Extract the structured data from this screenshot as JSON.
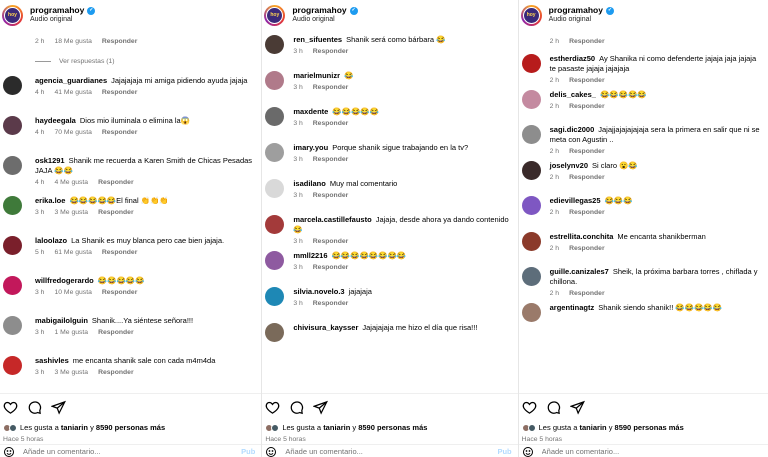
{
  "header": {
    "username": "programahoy",
    "audio": "Audio original",
    "logo_text": "hoy"
  },
  "panels": [
    {
      "top_meta": {
        "time": "2 h",
        "likes": "18 Me gusta",
        "reply": "Responder"
      },
      "view_replies": "Ver respuestas (1)",
      "comments": [
        {
          "user": "agencia_guardianes",
          "text": "Jajajajaja mi amiga pidiendo ayuda jajaja",
          "time": "4 h",
          "likes": "41 Me gusta",
          "reply": "Responder",
          "color": "#2b2b2b"
        },
        {
          "user": "haydeegala",
          "text": "Dios mio iluminala o elimina la😱",
          "time": "4 h",
          "likes": "70 Me gusta",
          "reply": "Responder",
          "color": "#5b3a4a"
        },
        {
          "user": "osk1291",
          "text": "Shanik me recuerda a Karen Smith de Chicas Pesadas JAJA 😂😂",
          "time": "4 h",
          "likes": "4 Me gusta",
          "reply": "Responder",
          "color": "#6d6d6d"
        },
        {
          "user": "erika.loe",
          "text": "😂😂😂😂😂El final 👏👏👏",
          "time": "3 h",
          "likes": "3 Me gusta",
          "reply": "Responder",
          "color": "#3f7a3a"
        },
        {
          "user": "laloolazo",
          "text": "La Shanik es muy blanca pero cae bien jajaja.",
          "time": "5 h",
          "likes": "61 Me gusta",
          "reply": "Responder",
          "color": "#7a1f2b"
        },
        {
          "user": "willfredogerardo",
          "text": "😂😂😂😂😂",
          "time": "3 h",
          "likes": "10 Me gusta",
          "reply": "Responder",
          "color": "#c2185b"
        },
        {
          "user": "mabigailolguin",
          "text": "Shanik....Ya siéntese señora!!!",
          "time": "3 h",
          "likes": "1 Me gusta",
          "reply": "Responder",
          "color": "#8d8d8d"
        },
        {
          "user": "sashivles",
          "text": "me encanta shanik sale con cada m4m4da",
          "time": "3 h",
          "likes": "3 Me gusta",
          "reply": "Responder",
          "color": "#c62828"
        }
      ],
      "likes_prefix": "Les gusta a",
      "likes_user": "taniarin",
      "likes_joiner": "y",
      "likes_count": "8590 personas más",
      "posted": "Hace 5 horas",
      "add_comment": "Añade un comentario...",
      "post": "Pub"
    },
    {
      "comments": [
        {
          "user": "ren_sifuentes",
          "text": "Shanik será como bárbara 😂",
          "time": "3 h",
          "likes": "",
          "reply": "Responder",
          "color": "#4a3b35"
        },
        {
          "user": "marielmunizr",
          "text": "😂",
          "time": "3 h",
          "likes": "",
          "reply": "Responder",
          "color": "#b07a8a"
        },
        {
          "user": "maxdente",
          "text": "😂😂😂😂😂",
          "time": "3 h",
          "likes": "",
          "reply": "Responder",
          "color": "#6a6a6a"
        },
        {
          "user": "imary.you",
          "text": "Porque shanik sigue trabajando en la tv?",
          "time": "3 h",
          "likes": "",
          "reply": "Responder",
          "color": "#9e9e9e"
        },
        {
          "user": "isadilano",
          "text": "Muy mal comentario",
          "time": "3 h",
          "likes": "",
          "reply": "Responder",
          "color": "#d9d9d9"
        },
        {
          "user": "marcela.castillefausto",
          "text": "Jajaja, desde ahora ya dando contenido 😂",
          "time": "3 h",
          "likes": "",
          "reply": "Responder",
          "color": "#a33a3a"
        },
        {
          "user": "mmll2216",
          "text": "😂😂😂😂😂😂😂😂",
          "time": "3 h",
          "likes": "",
          "reply": "Responder",
          "color": "#8e5aa0"
        },
        {
          "user": "silvia.novelo.3",
          "text": "jajajaja",
          "time": "3 h",
          "likes": "",
          "reply": "Responder",
          "color": "#1e88b5"
        },
        {
          "user": "chivisura_kaysser",
          "text": "Jajajajaja me hizo el día que risa!!!",
          "time": "",
          "likes": "",
          "reply": "",
          "color": "#7a6a5a"
        }
      ],
      "likes_prefix": "Les gusta a",
      "likes_user": "taniarin",
      "likes_joiner": "y",
      "likes_count": "8590 personas más",
      "posted": "Hace 5 horas",
      "add_comment": "Añade un comentario...",
      "post": "Pub"
    },
    {
      "top_meta": {
        "time": "2 h",
        "likes": "",
        "reply": "Responder"
      },
      "comments": [
        {
          "user": "estherdiaz50",
          "text": "Ay Shanika ni como defenderte jajaja jaja jajaja te pasaste jajaja jajajaja",
          "time": "2 h",
          "likes": "",
          "reply": "Responder",
          "color": "#b71c1c"
        },
        {
          "user": "delis_cakes_",
          "text": "😂😂😂😂😂",
          "time": "2 h",
          "likes": "",
          "reply": "Responder",
          "color": "#c48aa0"
        },
        {
          "user": "sagi.dic2000",
          "text": "Jajajjajajajajaja sera la primera en salir que ni se meta con Agustin ..",
          "time": "2 h",
          "likes": "",
          "reply": "Responder",
          "color": "#8d8d8d"
        },
        {
          "user": "joselynv20",
          "text": "Si claro 😮😂",
          "time": "2 h",
          "likes": "",
          "reply": "Responder",
          "color": "#3a2a2a"
        },
        {
          "user": "edievillegas25",
          "text": "😂😂😂",
          "time": "2 h",
          "likes": "",
          "reply": "Responder",
          "color": "#7e57c2"
        },
        {
          "user": "estrellita.conchita",
          "text": "Me encanta shanikberman",
          "time": "2 h",
          "likes": "",
          "reply": "Responder",
          "color": "#8b3a2a"
        },
        {
          "user": "guille.canizales7",
          "text": "Sheik, la próxima barbara torres , chiflada y chillona.",
          "time": "2 h",
          "likes": "",
          "reply": "Responder",
          "color": "#5d6d7a"
        },
        {
          "user": "argentinagtz",
          "text": "Shanik siendo shanik!! 😂😂😂😂😂",
          "time": "",
          "likes": "",
          "reply": "",
          "color": "#9a7a6a"
        }
      ],
      "likes_prefix": "Les gusta a",
      "likes_user": "taniarin",
      "likes_joiner": "y",
      "likes_count": "8590 personas más",
      "posted": "Hace 5 horas",
      "add_comment": "Añade un comentario...",
      "post": ""
    }
  ]
}
